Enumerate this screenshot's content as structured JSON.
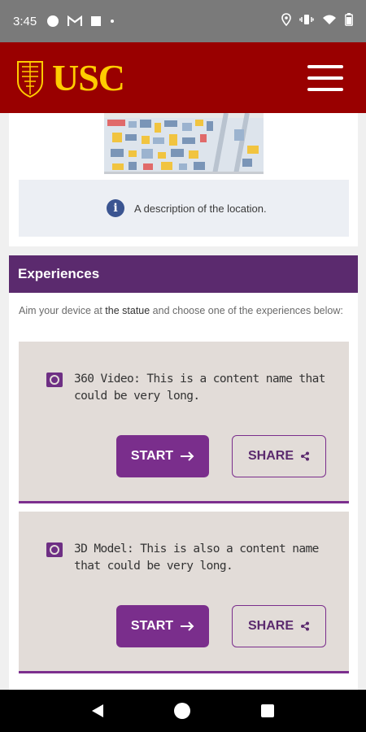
{
  "status_bar": {
    "time": "3:45",
    "left_icons": [
      "circle-notification-icon",
      "gmail-icon",
      "square-notification-icon",
      "dot-icon"
    ],
    "right_icons": [
      "location-icon",
      "vibrate-icon",
      "wifi-icon",
      "battery-icon"
    ]
  },
  "header": {
    "logo_text": "USC",
    "brand_color": "#990000",
    "logo_color": "#ffcc00"
  },
  "location": {
    "info_text": "A description of the location.",
    "info_icon_glyph": "i"
  },
  "experiences": {
    "heading": "Experiences",
    "intro_before": "Aim your device at ",
    "intro_highlight": "the statue",
    "intro_after": " and choose one of the experiences below:",
    "items": [
      {
        "title": "360 Video: This is a content name that could be very long.",
        "start_label": "START",
        "share_label": "SHARE"
      },
      {
        "title": "3D Model: This is also a content name that could be very long.",
        "start_label": "START",
        "share_label": "SHARE"
      }
    ],
    "accent_color": "#7a2e8c",
    "header_color": "#5b2a6e"
  }
}
